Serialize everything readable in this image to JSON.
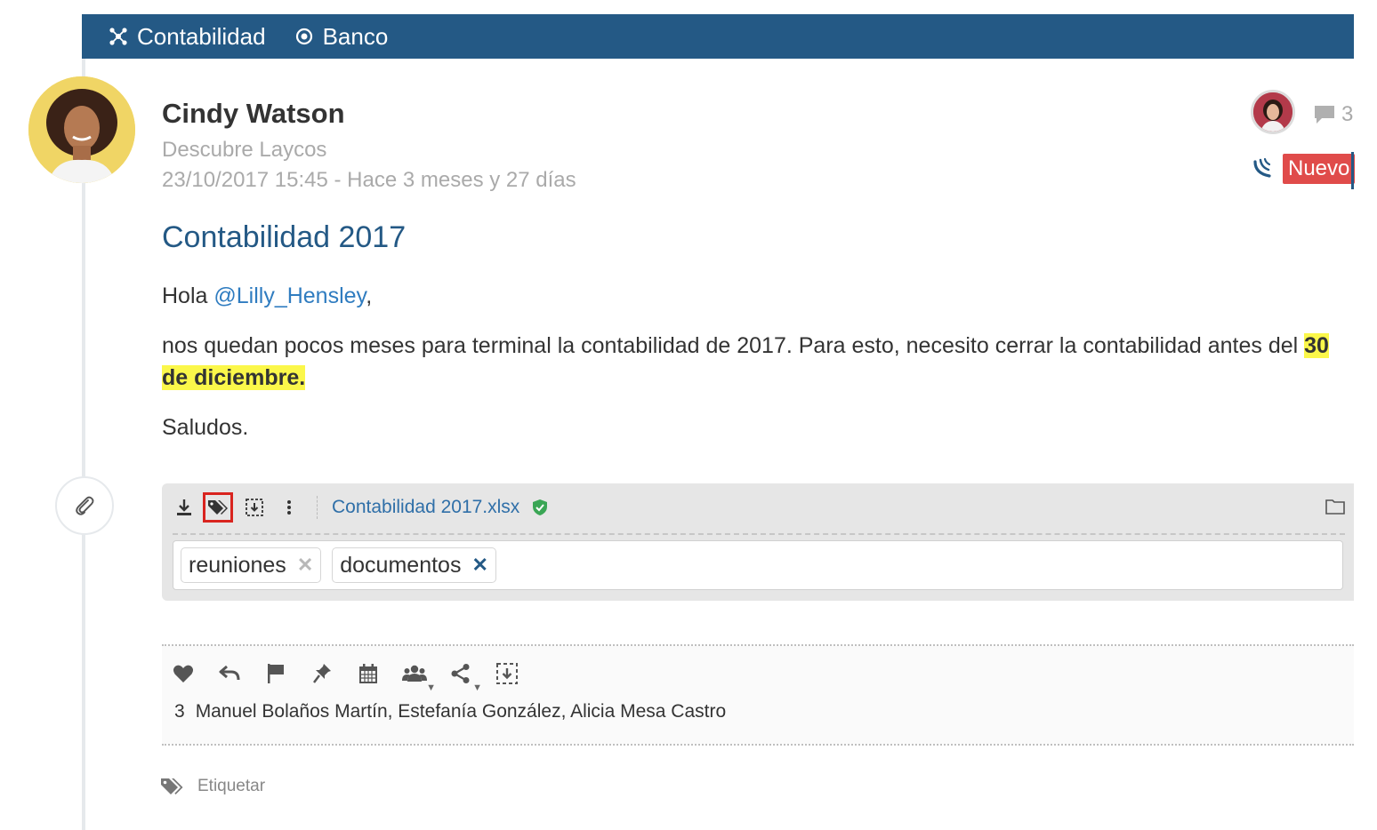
{
  "breadcrumbs": [
    {
      "label": "Contabilidad",
      "icon": "network-icon"
    },
    {
      "label": "Banco",
      "icon": "target-icon"
    }
  ],
  "post": {
    "author": "Cindy Watson",
    "subtitle": "Descubre Laycos",
    "date": "23/10/2017 15:45 - Hace 3 meses y 27 días",
    "comment_count": "3",
    "status_badge": "Nuevo",
    "title": "Contabilidad 2017",
    "greeting": "Hola",
    "mention": "@Lilly_Hensley",
    "greeting_suffix": ",",
    "paragraph_main": "nos quedan pocos meses para terminal la contabilidad de 2017. Para esto, necesito cerrar la contabilidad antes del",
    "paragraph_highlight": "30 de diciembre.",
    "closing": "Saludos."
  },
  "attachment": {
    "file_name": "Contabilidad 2017.xlsx",
    "tags": [
      {
        "label": "reuniones",
        "remove": "✕"
      },
      {
        "label": "documentos",
        "remove": "✕"
      }
    ]
  },
  "likes": {
    "count": "3",
    "names": "Manuel Bolaños Martín, Estefanía González, Alicia Mesa Castro"
  },
  "tag_action": "Etiquetar",
  "colors": {
    "brand": "#245985",
    "badge": "#e04b4a",
    "highlight": "#fbf74a",
    "link": "#2f7cc0"
  }
}
